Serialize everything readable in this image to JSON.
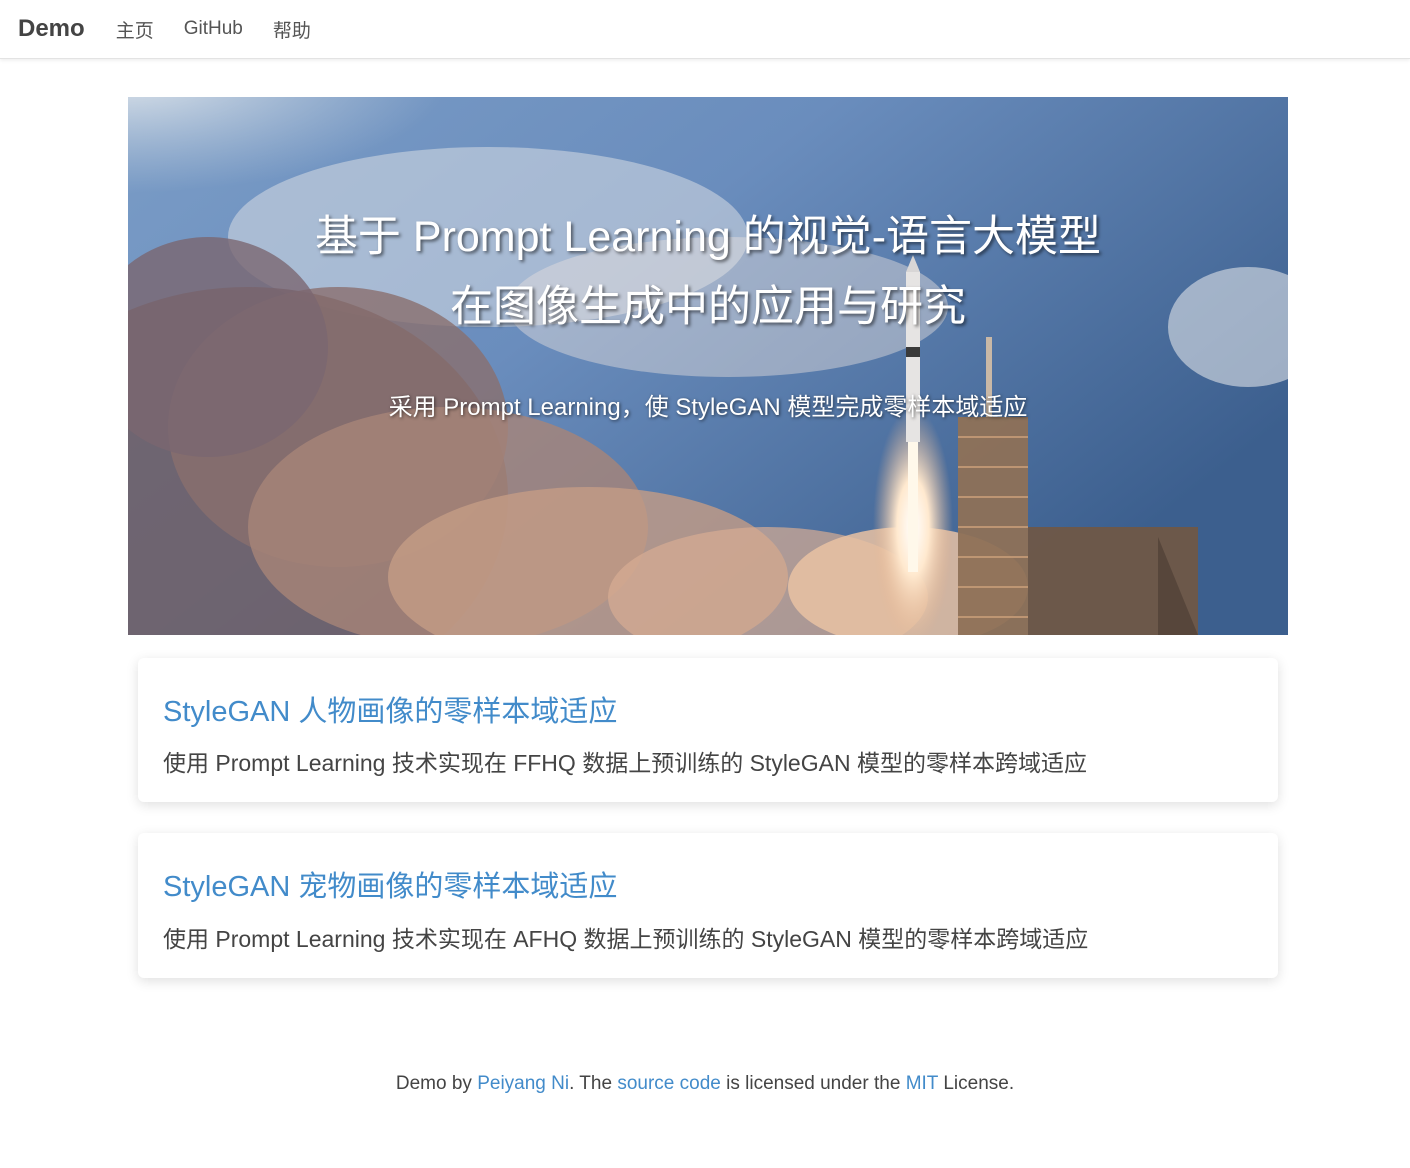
{
  "navbar": {
    "brand": "Demo",
    "items": [
      {
        "label": "主页"
      },
      {
        "label": "GitHub"
      },
      {
        "label": "帮助"
      }
    ]
  },
  "hero": {
    "title_line1": "基于 Prompt Learning 的视觉-语言大模型",
    "title_line2": "在图像生成中的应用与研究",
    "subtitle": "采用 Prompt Learning，使 StyleGAN 模型完成零样本域适应"
  },
  "cards": [
    {
      "title": "StyleGAN 人物画像的零样本域适应",
      "description": "使用 Prompt Learning 技术实现在 FFHQ 数据上预训练的 StyleGAN 模型的零样本跨域适应"
    },
    {
      "title": "StyleGAN 宠物画像的零样本域适应",
      "description": "使用 Prompt Learning 技术实现在 AFHQ 数据上预训练的 StyleGAN 模型的零样本跨域适应"
    }
  ],
  "footer": {
    "prefix": "Demo by ",
    "author": "Peiyang Ni",
    "middle1": ". The ",
    "source_link": "source code",
    "middle2": " is licensed under the ",
    "license_link": "MIT",
    "suffix": " License."
  }
}
